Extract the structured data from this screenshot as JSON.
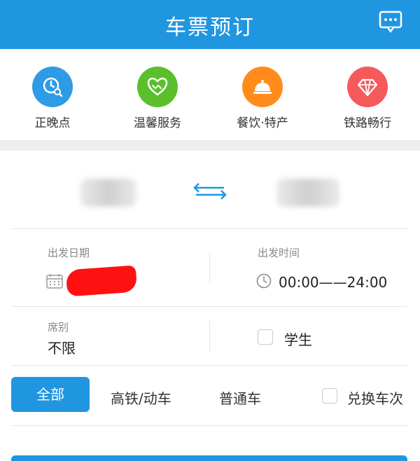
{
  "header": {
    "title": "车票预订",
    "message_icon": "message-icon"
  },
  "quick_links": [
    {
      "label": "正晚点",
      "icon": "clock-search-icon",
      "color": "#2d9be6"
    },
    {
      "label": "温馨服务",
      "icon": "heart-handshake-icon",
      "color": "#5bbf2c"
    },
    {
      "label": "餐饮·特产",
      "icon": "food-cloche-icon",
      "color": "#ff8c1a"
    },
    {
      "label": "铁路畅行",
      "icon": "diamond-icon",
      "color": "#f55a5a"
    }
  ],
  "stations": {
    "swap_icon": "swap-arrows-icon"
  },
  "departure_date": {
    "label": "出发日期",
    "icon": "calendar-icon"
  },
  "departure_time": {
    "label": "出发时间",
    "value": "00:00——24:00",
    "icon": "clock-icon"
  },
  "seat": {
    "label": "席别",
    "value": "不限"
  },
  "student": {
    "label": "学生"
  },
  "filters": {
    "all": "全部",
    "high_speed": "高铁/动车",
    "regular": "普通车",
    "exchange": "兑换车次"
  },
  "colors": {
    "accent": "#2196e0",
    "redaction": "#ff1111"
  }
}
